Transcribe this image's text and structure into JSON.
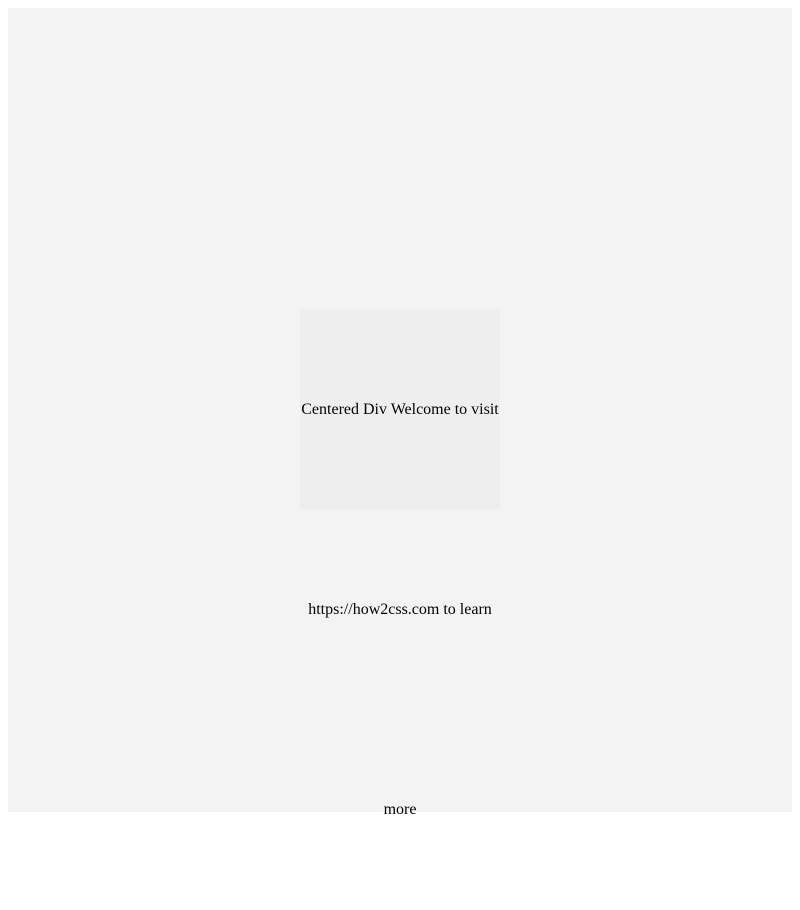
{
  "main": {
    "centered_text": "Centered Div Welcome to visit https://how2css.com to learn more"
  }
}
